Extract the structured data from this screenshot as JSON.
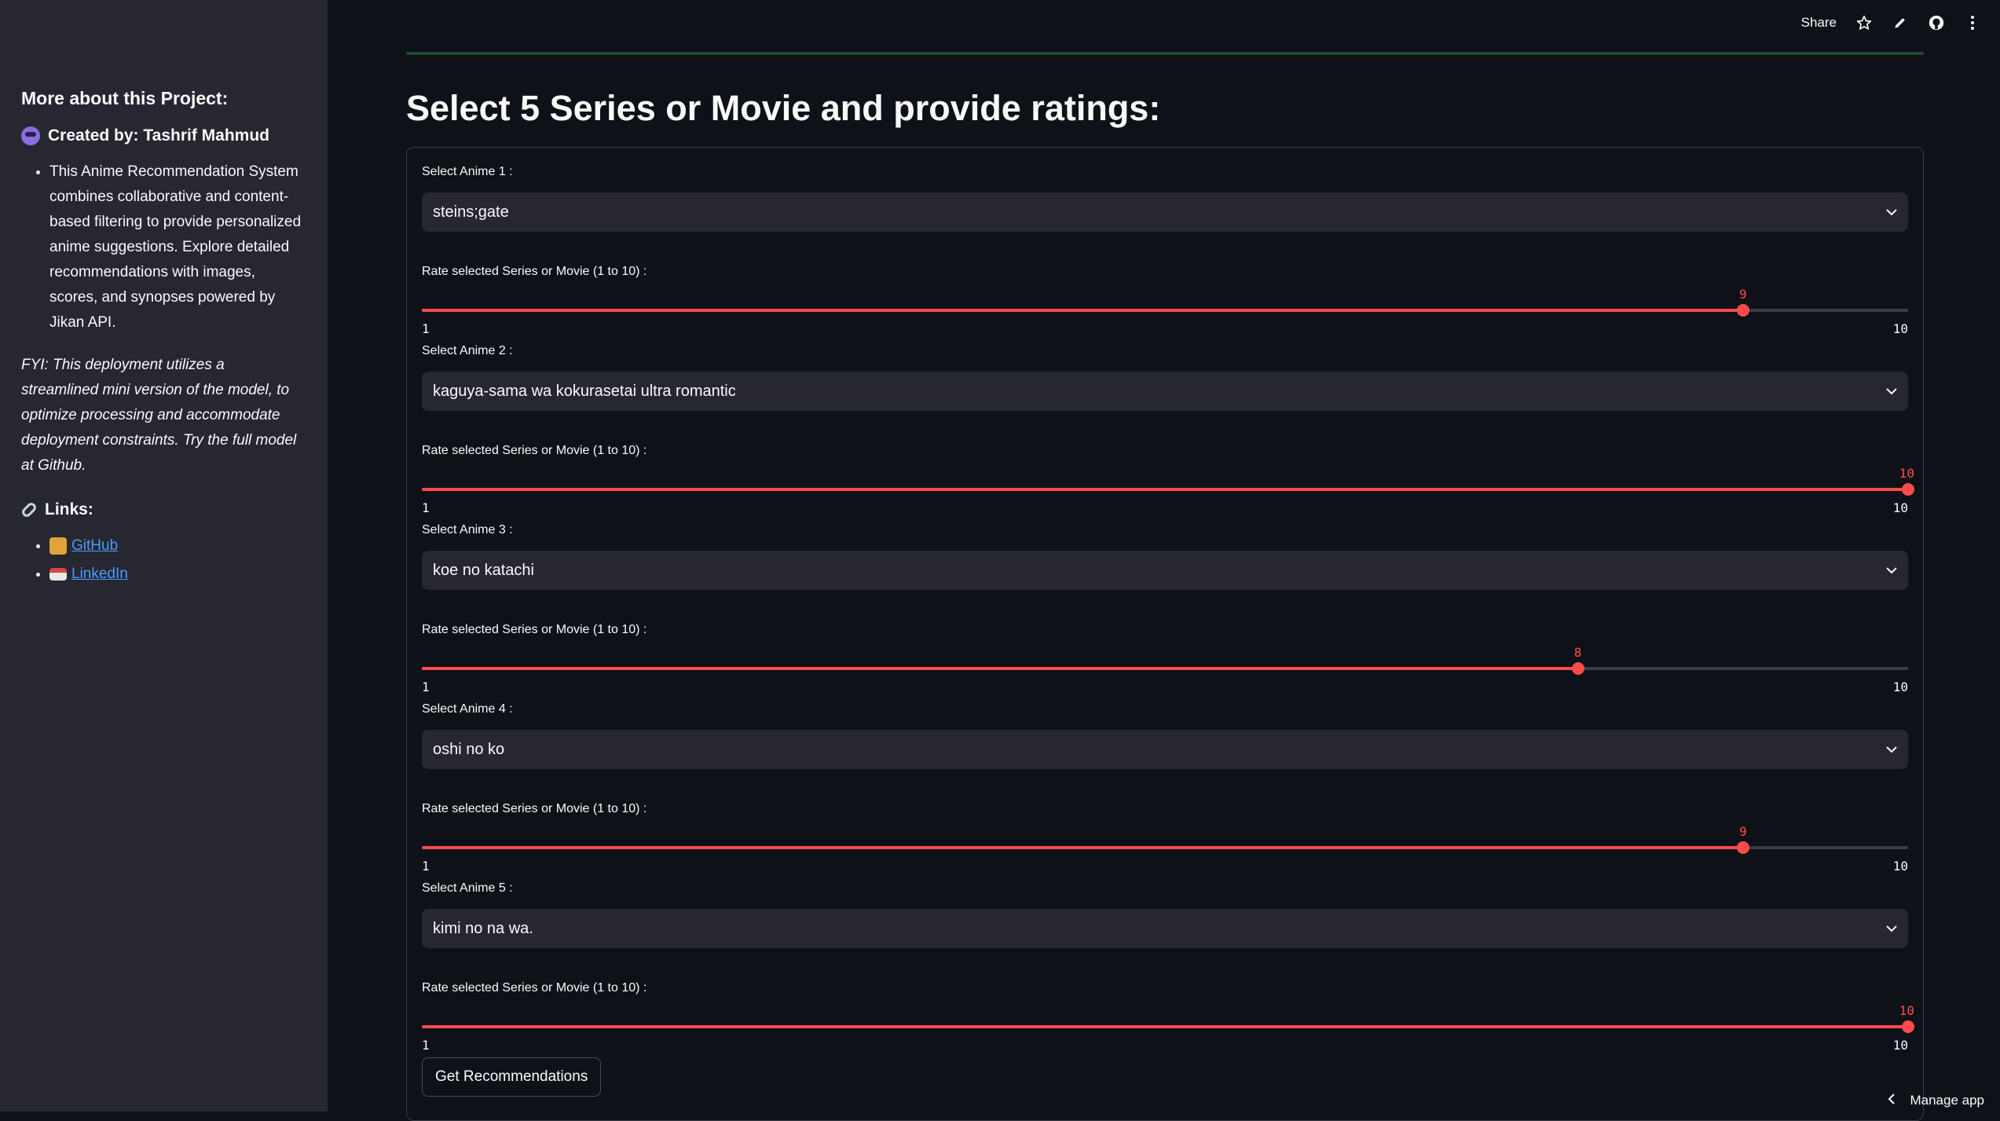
{
  "sidebar": {
    "heading": "More about this Project:",
    "creator": "Created by: Tashrif Mahmud",
    "description": "This Anime Recommendation System combines collaborative and content-based filtering to provide personalized anime suggestions. Explore detailed recommendations with images, scores, and synopses powered by Jikan API.",
    "fyi": "FYI: This deployment utilizes a streamlined mini version of the model, to optimize processing and accommodate deployment constraints. Try the full model at Github.",
    "links_heading": "Links:",
    "links": [
      {
        "label": "GitHub",
        "icon": "cat-icon"
      },
      {
        "label": "LinkedIn",
        "icon": "envelope-icon"
      }
    ]
  },
  "topbar": {
    "share_label": "Share",
    "icons": [
      "star-icon",
      "pencil-icon",
      "github-icon",
      "more-icon"
    ]
  },
  "main": {
    "title": "Select 5 Series or Movie and provide ratings:",
    "rating_label": "Rate selected Series or Movie (1 to 10) :",
    "slider_min": "1",
    "slider_max": "10",
    "entries": [
      {
        "label": "Select Anime 1 :",
        "value": "steins;gate",
        "rating": "9"
      },
      {
        "label": "Select Anime 2 :",
        "value": "kaguya-sama wa kokurasetai ultra romantic",
        "rating": "10"
      },
      {
        "label": "Select Anime 3 :",
        "value": "koe no katachi",
        "rating": "8"
      },
      {
        "label": "Select Anime 4 :",
        "value": "oshi no ko",
        "rating": "9"
      },
      {
        "label": "Select Anime 5 :",
        "value": "kimi no na wa.",
        "rating": "10"
      }
    ],
    "button_label": "Get Recommendations"
  },
  "footer": {
    "manage_label": "Manage app"
  },
  "colors": {
    "accent": "#ff4b4b",
    "background": "#0e1117",
    "sidebar": "#262730",
    "link": "#4a9bff"
  }
}
